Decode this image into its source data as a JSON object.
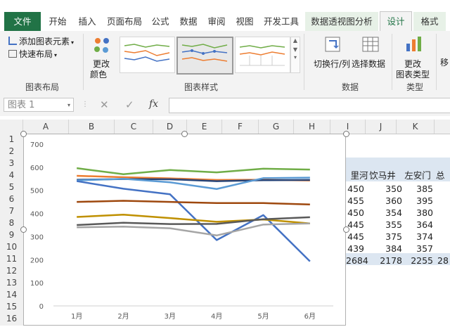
{
  "tabs": {
    "file": "文件",
    "home": "开始",
    "insert": "插入",
    "page_layout": "页面布局",
    "formulas": "公式",
    "data": "数据",
    "review": "审阅",
    "view": "视图",
    "developer": "开发工具",
    "pivot_analyze": "数据透视图分析",
    "design": "设计",
    "format": "格式"
  },
  "ribbon": {
    "add_element": "添加图表元素",
    "quick_layout": "快速布局",
    "change_colors_1": "更改",
    "change_colors_2": "颜色",
    "group_chart_layouts": "图表布局",
    "group_chart_styles": "图表样式",
    "switch_row_col": "切换行/列",
    "select_data": "选择数据",
    "group_data": "数据",
    "change_type_1": "更改",
    "change_type_2": "图表类型",
    "group_type": "类型",
    "move_partial": "移"
  },
  "formula_bar": {
    "name_box": "图表 1",
    "fx": "fx"
  },
  "columns": [
    "A",
    "B",
    "C",
    "D",
    "E",
    "F",
    "G",
    "H",
    "I",
    "J",
    "K"
  ],
  "rows": [
    "1",
    "2",
    "3",
    "4",
    "5",
    "6",
    "7",
    "8",
    "9",
    "10",
    "11",
    "12",
    "13",
    "14",
    "15",
    "16"
  ],
  "sheet": {
    "headers": [
      "里河",
      "饮马井",
      "左安门",
      "总"
    ],
    "data_rows": [
      [
        "450",
        "350",
        "385"
      ],
      [
        "455",
        "360",
        "395"
      ],
      [
        "450",
        "354",
        "380"
      ],
      [
        "445",
        "355",
        "364"
      ],
      [
        "445",
        "375",
        "374"
      ],
      [
        "439",
        "384",
        "357"
      ]
    ],
    "total_row": [
      "2684",
      "2178",
      "2255",
      "28"
    ]
  },
  "chart_data": {
    "type": "line",
    "categories": [
      "1月",
      "2月",
      "3月",
      "4月",
      "5月",
      "6月"
    ],
    "ylim": [
      0,
      700
    ],
    "yticks": [
      "0",
      "100",
      "200",
      "300",
      "400",
      "500",
      "600",
      "700"
    ],
    "grid": false,
    "series": [
      {
        "color": "#70ad47",
        "values": [
          596,
          570,
          588,
          578,
          594,
          590
        ]
      },
      {
        "color": "#ed7d31",
        "values": [
          563,
          557,
          552,
          545,
          546,
          543
        ]
      },
      {
        "color": "#264478",
        "values": [
          546,
          549,
          548,
          540,
          544,
          545
        ]
      },
      {
        "color": "#5b9bd5",
        "values": [
          543,
          550,
          535,
          506,
          553,
          555
        ]
      },
      {
        "color": "#4472c4",
        "values": [
          540,
          507,
          483,
          285,
          393,
          193
        ]
      },
      {
        "color": "#9e480e",
        "values": [
          450,
          455,
          450,
          445,
          445,
          439
        ]
      },
      {
        "color": "#bf9000",
        "values": [
          385,
          395,
          380,
          364,
          374,
          357
        ]
      },
      {
        "color": "#a5a5a5",
        "values": [
          340,
          343,
          336,
          305,
          352,
          357
        ]
      },
      {
        "color": "#595959",
        "values": [
          350,
          360,
          354,
          355,
          375,
          384
        ]
      }
    ]
  }
}
